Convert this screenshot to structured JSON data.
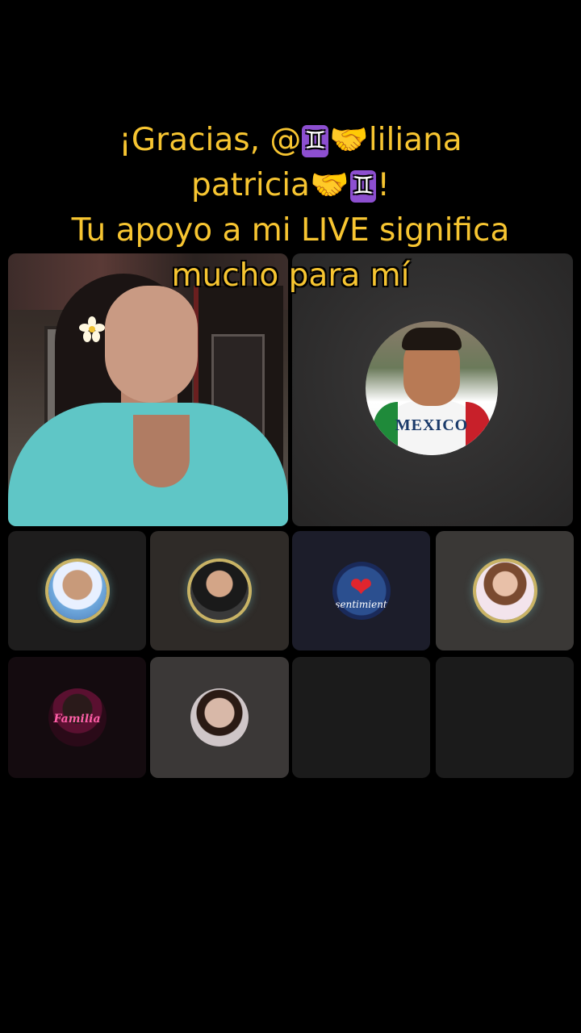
{
  "caption": {
    "line1_prefix": "¡Gracias, @",
    "emoji_gemini": "♊",
    "emoji_handshake": "🤝",
    "line1_suffix": "liliana",
    "line2_text": "patricia",
    "line2_end": "!",
    "line3": "Tu apoyo a mi LIVE significa",
    "line4": "mucho para mí"
  },
  "guests": {
    "big_avatar_shirt_text": "MEXICO",
    "tile_s3_label": "sentimient",
    "tile_s5_label": "Familia"
  },
  "colors": {
    "caption": "#f7c531",
    "background": "#000000"
  }
}
